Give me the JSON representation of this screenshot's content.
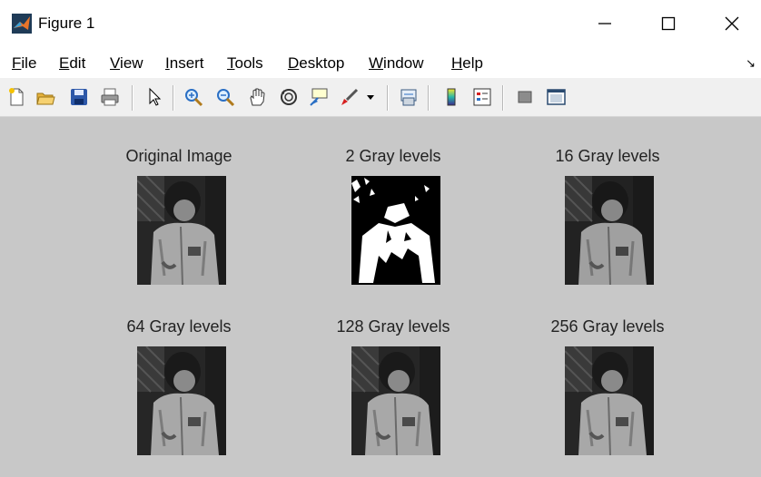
{
  "window": {
    "title": "Figure 1"
  },
  "menu": {
    "items": [
      {
        "label": "File",
        "mnemonic": "F",
        "rest": "ile"
      },
      {
        "label": "Edit",
        "mnemonic": "E",
        "rest": "dit"
      },
      {
        "label": "View",
        "mnemonic": "V",
        "rest": "iew"
      },
      {
        "label": "Insert",
        "mnemonic": "I",
        "rest": "nsert"
      },
      {
        "label": "Tools",
        "mnemonic": "T",
        "rest": "ools"
      },
      {
        "label": "Desktop",
        "mnemonic": "D",
        "rest": "esktop"
      },
      {
        "label": "Window",
        "mnemonic": "W",
        "rest": "indow"
      },
      {
        "label": "Help",
        "mnemonic": "H",
        "rest": "elp"
      }
    ]
  },
  "toolbar": {
    "icons": [
      "new-figure-icon",
      "open-file-icon",
      "save-icon",
      "print-icon",
      "select-arrow-icon",
      "zoom-in-icon",
      "zoom-out-icon",
      "pan-hand-icon",
      "rotate-3d-icon",
      "data-cursor-icon",
      "brush-icon",
      "dropdown-arrow-icon",
      "link-plot-icon",
      "colorbar-icon",
      "legend-icon",
      "hide-plot-tools-icon",
      "show-plot-tools-icon"
    ]
  },
  "subplots": [
    {
      "title": "Original Image",
      "style": "gray"
    },
    {
      "title": "2 Gray levels",
      "style": "binary"
    },
    {
      "title": "16 Gray levels",
      "style": "gray"
    },
    {
      "title": "64 Gray levels",
      "style": "gray"
    },
    {
      "title": "128 Gray levels",
      "style": "gray"
    },
    {
      "title": "256 Gray levels",
      "style": "gray"
    }
  ],
  "colors": {
    "figure_bg": "#c8c8c8",
    "toolbar_bg": "#f0f0f0",
    "accent_orange": "#e8742a"
  }
}
